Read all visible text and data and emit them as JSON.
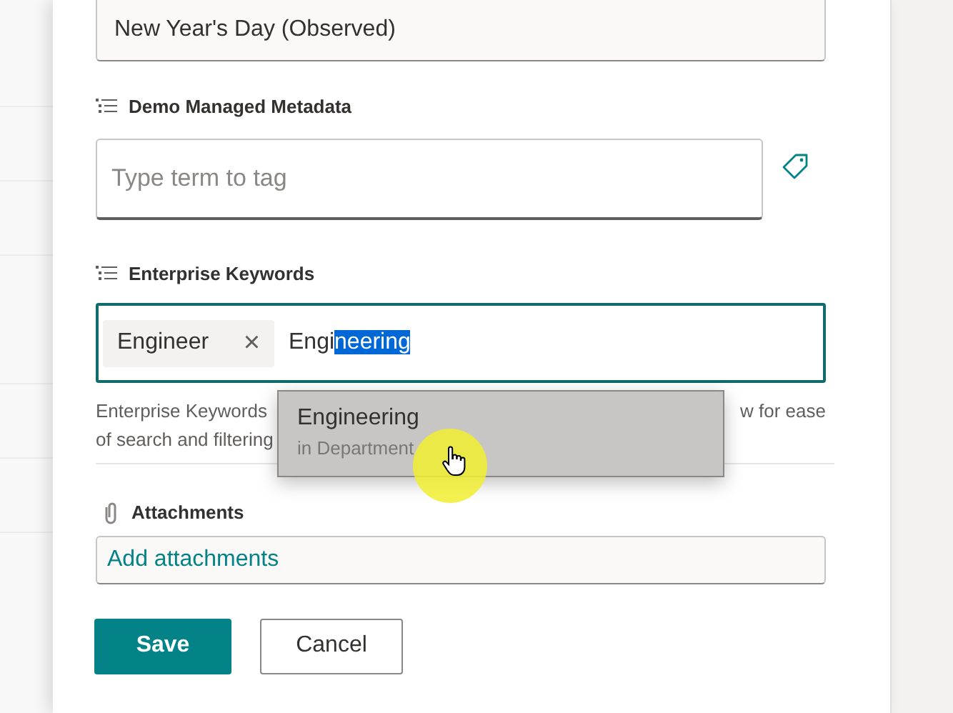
{
  "title_field": {
    "value": "New Year's Day (Observed)"
  },
  "managed_metadata": {
    "label": "Demo Managed Metadata",
    "placeholder": "Type term to tag"
  },
  "enterprise_keywords": {
    "label": "Enterprise Keywords",
    "focused": true,
    "chips": [
      {
        "label": "Engineer",
        "remove": "×"
      }
    ],
    "typed": "Engi",
    "selected_completion": "neering",
    "help_text": [
      "Enterprise Keywords",
      "w for ease",
      "of search and filtering"
    ]
  },
  "suggestions": [
    {
      "title": "Engineering",
      "subtitle": "in Department",
      "selected": true
    }
  ],
  "attachments": {
    "label": "Attachments",
    "link": "Add attachments"
  },
  "buttons": [
    {
      "label": "Save",
      "kind": "primary"
    },
    {
      "label": "Cancel",
      "kind": "secondary"
    }
  ]
}
